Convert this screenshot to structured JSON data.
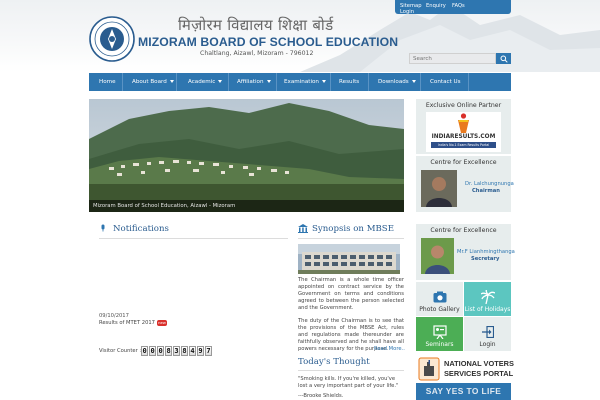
{
  "toplinks": {
    "sitemap": "Sitemap",
    "enquiry": "Enquiry",
    "faqs": "FAQs",
    "login": "Login"
  },
  "header": {
    "title_hindi": "मिज़ोरम विद्यालय शिक्षा बोर्ड",
    "title": "MIZORAM BOARD OF SCHOOL EDUCATION",
    "address": "Chaltlang, Aizawl, Mizoram - 796012",
    "search_placeholder": "Search"
  },
  "nav": {
    "home": "Home",
    "about": "About Board",
    "academic": "Academic",
    "affiliation": "Affiliation",
    "examination": "Examination",
    "results": "Results",
    "downloads": "Downloads",
    "contact": "Contact Us"
  },
  "banner": {
    "caption": "Mizoram Board of School Education, Aizawl - Mizoram"
  },
  "notifications": {
    "title": "Notifications",
    "date": "09/10/2017",
    "item": "Results of MTET 2017",
    "new_badge": "new",
    "visitor_label": "Visitor Counter :",
    "visitor_digits": [
      "0",
      "0",
      "0",
      "8",
      "3",
      "8",
      "4",
      "9",
      "7"
    ]
  },
  "synopsis": {
    "title": "Synopsis on MBSE",
    "para1": "The Chairman is a whole time officer appointed on contract service by the Government on terms and conditions agreed to between the person selected and the Government.",
    "para2": "The duty of the Chairman is to see that the provisions of the MBSE Act, rules and regulations made thereunder are faithfully observed and he shall have all powers necessary for the purpose.",
    "read_more": "Read More.."
  },
  "thought": {
    "title": "Today's Thought",
    "quote": "\"Smoking kills. If you're killed, you've lost a very important part of your life.\"",
    "author": "---Brooke Shields."
  },
  "sidebar": {
    "partner_title": "Exclusive Online Partner",
    "partner_logo": "INDIARESULTS.COM",
    "partner_tagline": "India's No.1 Exam Results Portal",
    "excellence_title": "Centre for Excellence",
    "chairman_name": "Dr. Lalchungnunga",
    "chairman_role": "Chairman",
    "excellence_title2": "Centre for Excellence",
    "secretary_name": "Mr.F Lianhmingthanga",
    "secretary_role": "Secretary",
    "tiles": {
      "photo": "Photo Gallery",
      "holidays": "List of Holidays",
      "seminars": "Seminars",
      "login": "Login"
    },
    "nvsp_line1": "NATIONAL VOTERS",
    "nvsp_line2": "SERVICES PORTAL",
    "nvsp_slogan": "SAY YES TO LIFE"
  },
  "colors": {
    "primary": "#2e76b0",
    "tile_teal": "#3fa6a0",
    "tile_light": "#5cc6c0",
    "tile_green": "#4cae55"
  }
}
